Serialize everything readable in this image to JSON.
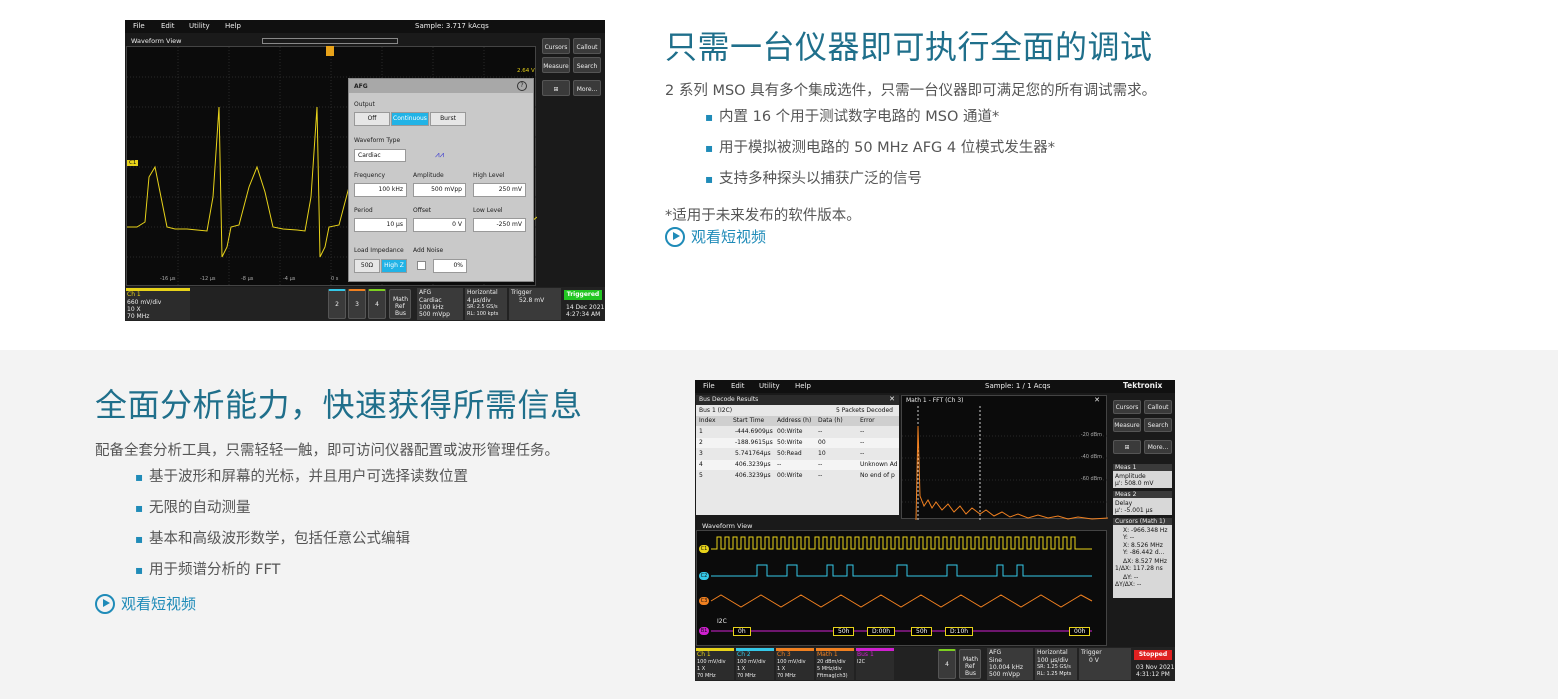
{
  "section1": {
    "title": "只需一台仪器即可执行全面的调试",
    "lead": "2 系列 MSO 具有多个集成选件，只需一台仪器即可满足您的所有调试需求。",
    "bullets": [
      "内置 16 个用于测试数字电路的 MSO 通道*",
      "用于模拟被测电路的 50 MHz AFG 4 位模式发生器*",
      "支持多种探头以捕获广泛的信号"
    ],
    "note": "*适用于未来发布的软件版本。",
    "video_link": "观看短视频",
    "scope": {
      "menu": [
        "File",
        "Edit",
        "Utility",
        "Help"
      ],
      "sample": "Sample: 3.717 kAcqs",
      "view_title": "Waveform View",
      "right_buttons": [
        "Cursors",
        "Callout",
        "Measure",
        "Search",
        "More..."
      ],
      "afg": {
        "title": "AFG",
        "output_label": "Output",
        "output_options": [
          "Off",
          "Continuous",
          "Burst"
        ],
        "waveform_type_label": "Waveform Type",
        "waveform_type": "Cardiac",
        "frequency_label": "Frequency",
        "frequency": "100 kHz",
        "amplitude_label": "Amplitude",
        "amplitude": "500 mVpp",
        "high_level_label": "High Level",
        "high_level": "250 mV",
        "period_label": "Period",
        "period": "10 µs",
        "offset_label": "Offset",
        "offset": "0 V",
        "low_level_label": "Low Level",
        "low_level": "-250 mV",
        "load_impedance_label": "Load Impedance",
        "load_options": [
          "50Ω",
          "High Z"
        ],
        "add_noise_label": "Add Noise",
        "noise": "0%"
      },
      "volt_label": "2.64 V",
      "ch_marker": "C1",
      "time_ticks": [
        "-16 µs",
        "-12 µs",
        "-8 µs",
        "-4 µs",
        "0 s"
      ],
      "status": {
        "ch1_title": "Ch 1",
        "ch1_lines": [
          "660 mV/div",
          "10 X",
          "70 MHz"
        ],
        "ch_buttons": [
          "2",
          "3",
          "4"
        ],
        "math": [
          "Math",
          "Ref",
          "Bus"
        ],
        "afg_title": "AFG",
        "afg_lines": [
          "Cardiac",
          "100 kHz",
          "500 mVpp"
        ],
        "horiz_title": "Horizontal",
        "horiz_lines": [
          "4 µs/div",
          "SR: 2.5 GS/s",
          "RL: 100 kpts"
        ],
        "trigger_title": "Trigger",
        "trigger_line": "52.8 mV",
        "triggered": "Triggered",
        "date": "14 Dec 2021",
        "time": "4:27:34 AM"
      }
    }
  },
  "section2": {
    "title": "全面分析能力，快速获得所需信息",
    "lead": "配备全套分析工具，只需轻轻一触，即可访问仪器配置或波形管理任务。",
    "bullets": [
      "基于波形和屏幕的光标，并且用户可选择读数位置",
      "无限的自动测量",
      "基本和高级波形数学，包括任意公式编辑",
      "用于频谱分析的 FFT"
    ],
    "video_link": "观看短视频",
    "scope": {
      "menu": [
        "File",
        "Edit",
        "Utility",
        "Help"
      ],
      "sample": "Sample: 1 / 1 Acqs",
      "brand": "Tektronix",
      "bus_title": "Bus Decode Results",
      "bus_name": "Bus 1 (I2C)",
      "packets": "5 Packets Decoded",
      "columns": [
        "Index",
        "Start Time",
        "Address (h)",
        "Data (h)",
        "Error"
      ],
      "rows": [
        [
          "1",
          "-444.6909µs",
          "00:Write",
          "--",
          "--"
        ],
        [
          "2",
          "-188.9615µs",
          "50:Write",
          "00",
          "--"
        ],
        [
          "3",
          "5.741764µs",
          "50:Read",
          "10",
          "--"
        ],
        [
          "4",
          "406.3239µs",
          "--",
          "--",
          "Unknown Ad"
        ],
        [
          "5",
          "406.3239µs",
          "00:Write",
          "--",
          "No end of p"
        ]
      ],
      "fft_title": "Math 1 - FFT (Ch 3)",
      "fft_db": [
        "-20 dBm",
        "-40 dBm",
        "-60 dBm"
      ],
      "view_title": "Waveform View",
      "bus_label": "I2C",
      "bus_packets": [
        "0h",
        "50h",
        "D:00h",
        "50h",
        "D:10h",
        "00h"
      ],
      "right_buttons": [
        "Cursors",
        "Callout",
        "Measure",
        "Search",
        "More..."
      ],
      "meas1_title": "Meas 1",
      "meas1_lines": [
        "Amplitude",
        "µ': 508.0 mV"
      ],
      "meas2_title": "Meas 2",
      "meas2_lines": [
        "Delay",
        "µ': -5.001 µs"
      ],
      "cursors_title": "Cursors (Math 1)",
      "cursors_lines": [
        "X: -966.348 Hz",
        "Y: --",
        "X: 8.526 MHz",
        "Y: -86.442 d...",
        "ΔX: 8.527 MHz",
        "1/ΔX: 117.28 ns",
        "ΔY: --",
        "ΔY/ΔX: --"
      ],
      "status": {
        "ch1_title": "Ch 1",
        "ch1_lines": [
          "100 mV/div",
          "1 X",
          "70 MHz"
        ],
        "ch2_title": "Ch 2",
        "ch2_lines": [
          "100 mV/div",
          "1 X",
          "70 MHz"
        ],
        "ch3_title": "Ch 3",
        "ch3_lines": [
          "100 mV/div",
          "1 X",
          "70 MHz"
        ],
        "math1_title": "Math 1",
        "math1_lines": [
          "20 dBm/div",
          "5 MHz/div",
          "Fftmag(ch3)"
        ],
        "bus1_title": "Bus 1",
        "bus1_lines": [
          "I2C"
        ],
        "ch4": "4",
        "math": [
          "Math",
          "Ref",
          "Bus"
        ],
        "afg_title": "AFG",
        "afg_lines": [
          "Sine",
          "10.004 kHz",
          "500 mVpp"
        ],
        "horiz_title": "Horizontal",
        "horiz_lines": [
          "100 µs/div",
          "SR: 1.25 GS/s",
          "RL: 1.25 Mpts"
        ],
        "trigger_title": "Trigger",
        "trigger_line": "0 V",
        "stopped": "Stopped",
        "date": "03 Nov 2021",
        "time": "4:31:12 PM"
      }
    }
  }
}
